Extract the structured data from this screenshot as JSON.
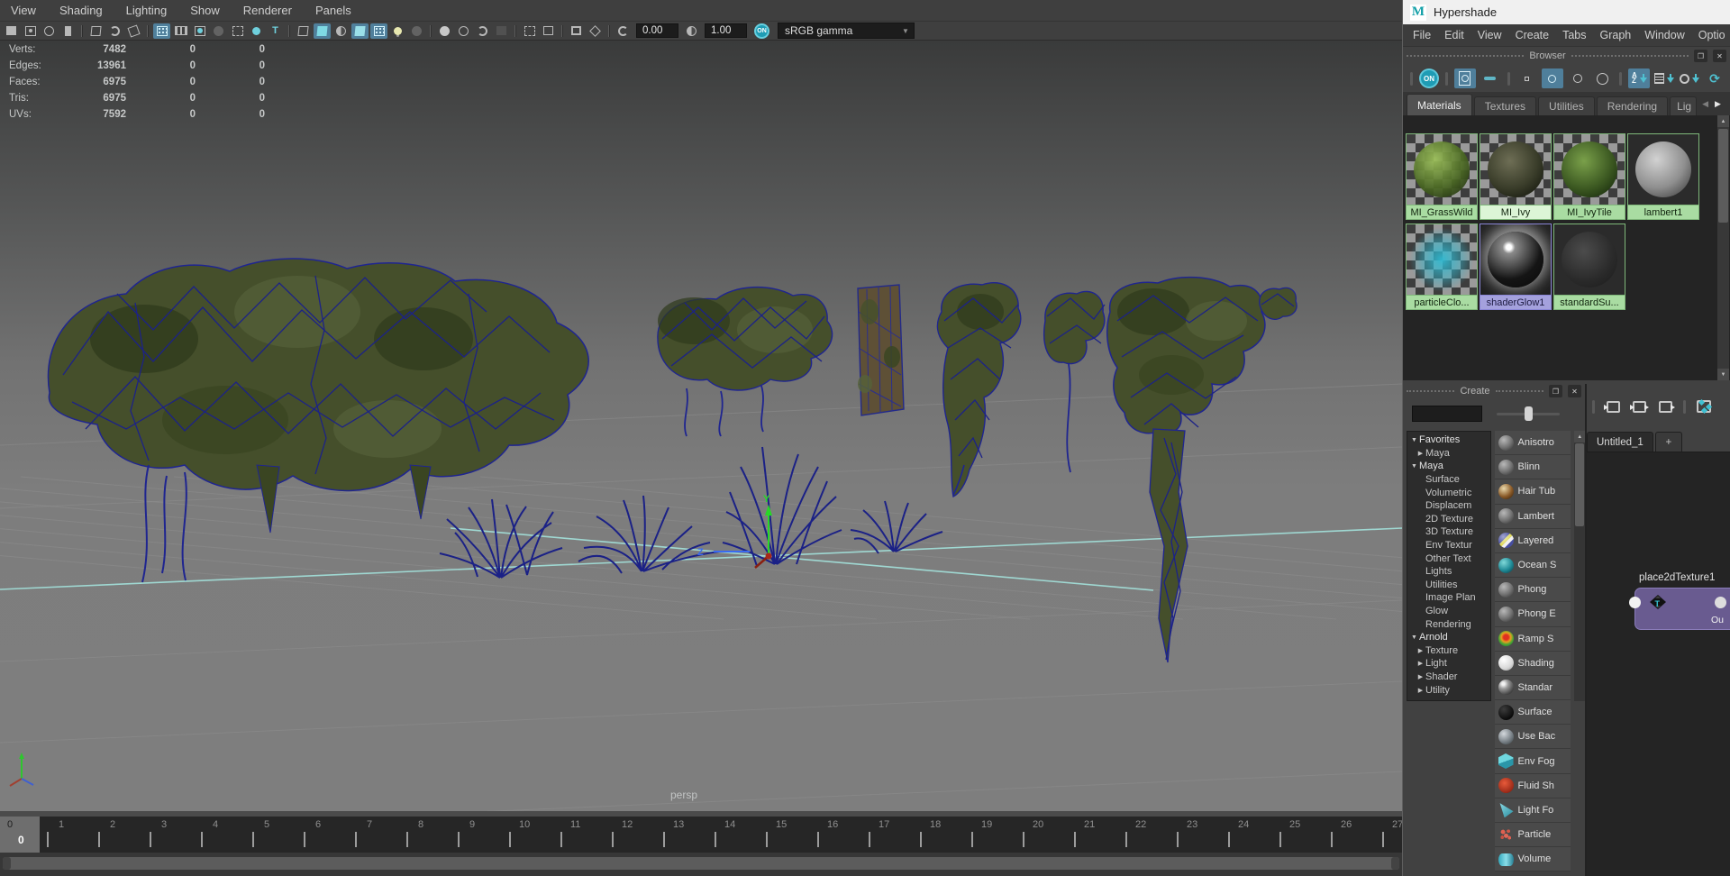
{
  "viewport": {
    "menus": [
      "View",
      "Shading",
      "Lighting",
      "Show",
      "Renderer",
      "Panels"
    ],
    "toolbar": {
      "exposure": "0.00",
      "gamma": "1.00",
      "on": "ON",
      "view_transform": "sRGB gamma"
    },
    "hud": {
      "rows": [
        {
          "label": "Verts:",
          "value": "7482",
          "c2": "0",
          "c3": "0"
        },
        {
          "label": "Edges:",
          "value": "13961",
          "c2": "0",
          "c3": "0"
        },
        {
          "label": "Faces:",
          "value": "6975",
          "c2": "0",
          "c3": "0"
        },
        {
          "label": "Tris:",
          "value": "6975",
          "c2": "0",
          "c3": "0"
        },
        {
          "label": "UVs:",
          "value": "7592",
          "c2": "0",
          "c3": "0"
        }
      ]
    },
    "camera_label": "persp",
    "gizmo_labels": {
      "y": "Y",
      "z": "Z"
    }
  },
  "timeline": {
    "frames": [
      "0",
      "1",
      "2",
      "3",
      "4",
      "5",
      "6",
      "7",
      "8",
      "9",
      "10",
      "11",
      "12",
      "13",
      "14",
      "15",
      "16",
      "17",
      "18",
      "19",
      "20",
      "21",
      "22",
      "23",
      "24",
      "25",
      "26",
      "27"
    ],
    "current_frame": "0"
  },
  "hypershade": {
    "title": "Hypershade",
    "logo": "M",
    "menus": [
      "File",
      "Edit",
      "View",
      "Create",
      "Tabs",
      "Graph",
      "Window",
      "Optio"
    ],
    "browser": {
      "header": "Browser",
      "on": "ON",
      "tabs": [
        "Materials",
        "Textures",
        "Utilities",
        "Rendering",
        "Lig"
      ],
      "active_tab": "Materials",
      "swatches": [
        {
          "label": "MI_GrassWild"
        },
        {
          "label": "MI_Ivy"
        },
        {
          "label": "MI_IvyTile"
        },
        {
          "label": "lambert1"
        },
        {
          "label": "particleClo..."
        },
        {
          "label": "shaderGlow1"
        },
        {
          "label": "standardSu..."
        }
      ]
    },
    "create": {
      "header": "Create",
      "tree": [
        {
          "label": "Favorites",
          "arrow": "▼"
        },
        {
          "label": "Maya",
          "arrow": "▶"
        },
        {
          "label": "Maya",
          "arrow": "▼"
        },
        {
          "label": "Surface",
          "arrow": ""
        },
        {
          "label": "Volumetric",
          "arrow": ""
        },
        {
          "label": "Displacem",
          "arrow": ""
        },
        {
          "label": "2D Texture",
          "arrow": ""
        },
        {
          "label": "3D Texture",
          "arrow": ""
        },
        {
          "label": "Env Textur",
          "arrow": ""
        },
        {
          "label": "Other Text",
          "arrow": ""
        },
        {
          "label": "Lights",
          "arrow": ""
        },
        {
          "label": "Utilities",
          "arrow": ""
        },
        {
          "label": "Image Plan",
          "arrow": ""
        },
        {
          "label": "Glow",
          "arrow": ""
        },
        {
          "label": "Rendering",
          "arrow": ""
        },
        {
          "label": "Arnold",
          "arrow": "▼"
        },
        {
          "label": "Texture",
          "arrow": "▶"
        },
        {
          "label": "Light",
          "arrow": "▶"
        },
        {
          "label": "Shader",
          "arrow": "▶"
        },
        {
          "label": "Utility",
          "arrow": "▶"
        }
      ],
      "list": [
        {
          "label": "Anisotro"
        },
        {
          "label": "Blinn"
        },
        {
          "label": "Hair Tub"
        },
        {
          "label": "Lambert"
        },
        {
          "label": "Layered"
        },
        {
          "label": "Ocean S"
        },
        {
          "label": "Phong"
        },
        {
          "label": "Phong E"
        },
        {
          "label": "Ramp S"
        },
        {
          "label": "Shading"
        },
        {
          "label": "Standar"
        },
        {
          "label": "Surface"
        },
        {
          "label": "Use Bac"
        },
        {
          "label": "Env Fog"
        },
        {
          "label": "Fluid Sh"
        },
        {
          "label": "Light Fo"
        },
        {
          "label": "Particle"
        },
        {
          "label": "Volume"
        }
      ]
    },
    "workarea": {
      "tab": "Untitled_1",
      "add_tab": "+",
      "node": {
        "title": "place2dTexture1",
        "out_label": "Ou"
      }
    }
  },
  "icons": {
    "dropdown": "▼",
    "up": "▲",
    "prev": "◀",
    "next": "▶",
    "close": "✕",
    "float": "❐",
    "t": "T",
    "refresh": "⟳",
    "sort_a": "A",
    "sort_z": "Z"
  },
  "colors": {
    "accent_teal": "#45b4c3",
    "highlight_blue": "#50809c",
    "label_green": "#a9dca2",
    "label_green_selected": "#dcf5d6",
    "label_lavender": "#a4a1dd",
    "node_purple": "#695b90",
    "wireframe_navy": "#1d2383",
    "axis_cyan": "#9fd8d2",
    "viewport_gray": "#7d7d7d"
  }
}
